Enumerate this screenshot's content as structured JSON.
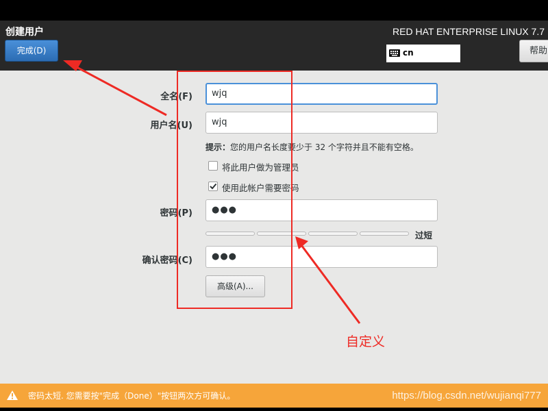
{
  "header": {
    "title": "创建用户",
    "done_label": "完成(D)",
    "product": "RED HAT ENTERPRISE LINUX 7.7",
    "keyboard_layout": "cn",
    "help_label": "帮助"
  },
  "form": {
    "fullname": {
      "label": "全名(F)",
      "value": "wjq"
    },
    "username": {
      "label": "用户名(U)",
      "value": "wjq"
    },
    "hint_prefix": "提示：",
    "hint_text": "您的用户名长度要少于 32 个字符并且不能有空格。",
    "admin_checkbox": {
      "label": "将此用户做为管理员",
      "checked": false
    },
    "require_password_checkbox": {
      "label": "使用此帐户需要密码",
      "checked": true
    },
    "password": {
      "label": "密码(P)",
      "value": "●●●"
    },
    "strength_label": "过短",
    "strength_level": 0,
    "confirm": {
      "label": "确认密码(C)",
      "value": "●●●"
    },
    "advanced_label": "高级(A)..."
  },
  "annotation": {
    "text": "自定义",
    "color": "#ee2a24"
  },
  "warning": {
    "text": "密码太短. 您需要按\"完成（Done）\"按钮两次方可确认。",
    "color": "#f6a53a"
  },
  "watermark": "https://blog.csdn.net/wujianqi777"
}
